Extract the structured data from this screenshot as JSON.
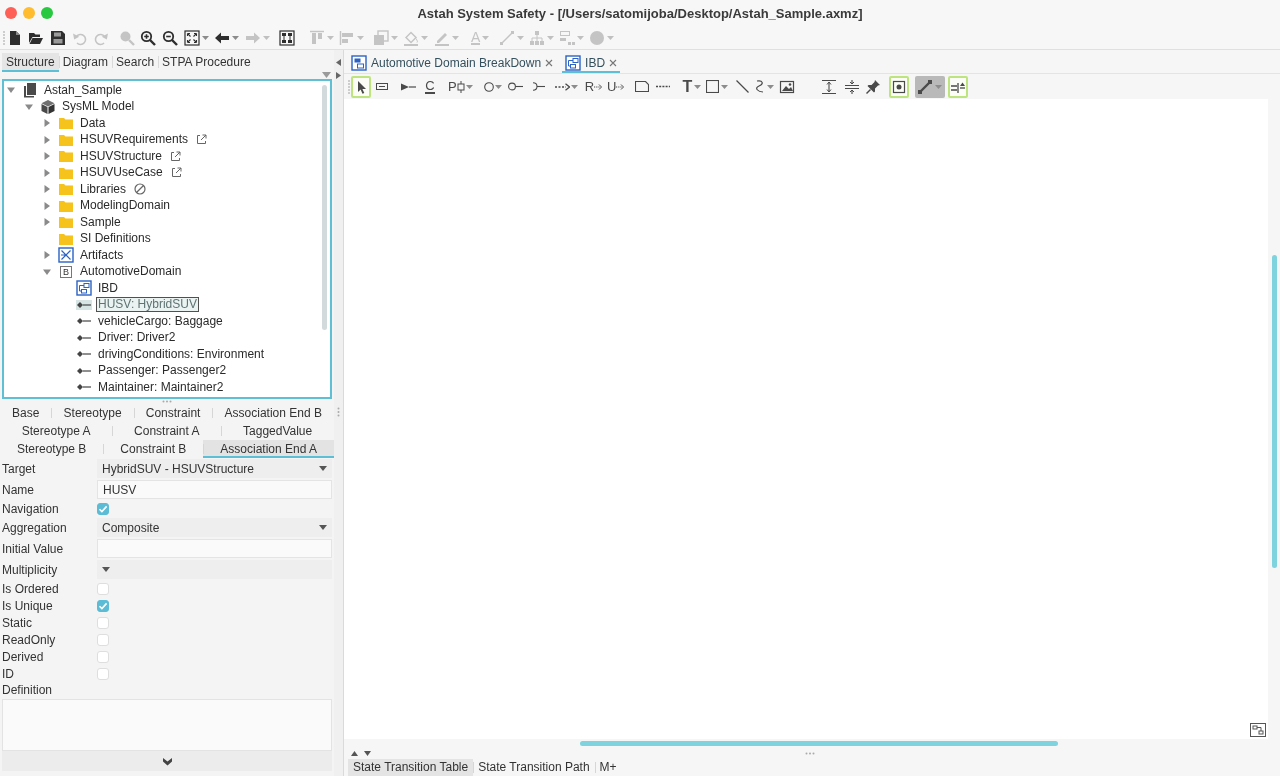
{
  "window": {
    "title": "Astah System Safety - [/Users/satomijoba/Desktop/Astah_Sample.axmz]"
  },
  "toolbar": [
    {
      "kind": "new",
      "disabled": false,
      "menu": false
    },
    {
      "kind": "open",
      "disabled": false,
      "menu": false
    },
    {
      "kind": "save",
      "disabled": false,
      "menu": false
    },
    {
      "kind": "undo",
      "disabled": true,
      "menu": false
    },
    {
      "kind": "redo",
      "disabled": true,
      "menu": false
    },
    {
      "kind": "find",
      "disabled": true,
      "menu": false
    },
    {
      "kind": "zoom-in",
      "disabled": false,
      "menu": false
    },
    {
      "kind": "zoom-out",
      "disabled": false,
      "menu": false
    },
    {
      "kind": "fit",
      "disabled": false,
      "menu": true
    },
    {
      "kind": "back",
      "disabled": false,
      "menu": true
    },
    {
      "kind": "forward",
      "disabled": true,
      "menu": true
    },
    {
      "kind": "layout",
      "disabled": false,
      "menu": false
    },
    {
      "kind": "align-top",
      "disabled": true,
      "menu": true
    },
    {
      "kind": "align-left",
      "disabled": true,
      "menu": true
    },
    {
      "kind": "arrange",
      "disabled": true,
      "menu": true
    },
    {
      "kind": "fill",
      "disabled": true,
      "menu": true
    },
    {
      "kind": "line-color",
      "disabled": true,
      "menu": true
    },
    {
      "kind": "font-color",
      "disabled": true,
      "menu": true,
      "glyph": "A"
    },
    {
      "kind": "line-style",
      "disabled": true,
      "menu": true
    },
    {
      "kind": "tree-layout",
      "disabled": true,
      "menu": true
    },
    {
      "kind": "distribute",
      "disabled": true,
      "menu": true
    },
    {
      "kind": "shape",
      "disabled": true,
      "menu": true
    }
  ],
  "left_panel": {
    "tabs": [
      {
        "label": "Structure",
        "selected": true
      },
      {
        "label": "Diagram",
        "selected": false
      },
      {
        "label": "Search",
        "selected": false
      },
      {
        "label": "STPA Procedure",
        "selected": false
      }
    ],
    "tree": [
      {
        "label": "Astah_Sample",
        "kind": "project",
        "expanded": true,
        "selected": false,
        "children": [
          {
            "label": "SysML Model",
            "kind": "model",
            "expanded": true,
            "selected": false,
            "children": [
              {
                "label": "Data",
                "kind": "folder",
                "expanded": false,
                "selected": false
              },
              {
                "label": "HSUVRequirements",
                "kind": "linked-folder",
                "expanded": false,
                "selected": false
              },
              {
                "label": "HSUVStructure",
                "kind": "linked-folder",
                "expanded": false,
                "selected": false
              },
              {
                "label": "HSUVUseCase",
                "kind": "linked-folder",
                "expanded": false,
                "selected": false
              },
              {
                "label": "Libraries",
                "kind": "blocked-folder",
                "expanded": false,
                "selected": false
              },
              {
                "label": "ModelingDomain",
                "kind": "folder",
                "expanded": false,
                "selected": false
              },
              {
                "label": "Sample",
                "kind": "folder",
                "expanded": false,
                "selected": false
              },
              {
                "label": "SI Definitions",
                "kind": "folder",
                "selected": false
              },
              {
                "label": "Artifacts",
                "kind": "diagram",
                "expanded": false,
                "selected": false
              },
              {
                "label": "AutomotiveDomain",
                "kind": "block",
                "glyph": "B",
                "expanded": true,
                "selected": false,
                "children": [
                  {
                    "label": "IBD",
                    "kind": "ibd",
                    "selected": false
                  },
                  {
                    "label": "HUSV: HybridSUV",
                    "kind": "part",
                    "selected": true
                  },
                  {
                    "label": "vehicleCargo: Baggage",
                    "kind": "part",
                    "selected": false
                  },
                  {
                    "label": "Driver: Driver2",
                    "kind": "part",
                    "selected": false
                  },
                  {
                    "label": "drivingConditions: Environment",
                    "kind": "part",
                    "selected": false
                  },
                  {
                    "label": "Passenger: Passenger2",
                    "kind": "part",
                    "selected": false
                  },
                  {
                    "label": "Maintainer: Maintainer2",
                    "kind": "part",
                    "selected": false
                  }
                ]
              }
            ]
          }
        ]
      }
    ]
  },
  "properties": {
    "tab_rows": [
      [
        {
          "label": "Base",
          "selected": false
        },
        {
          "label": "Stereotype",
          "selected": false
        },
        {
          "label": "Constraint",
          "selected": false
        },
        {
          "label": "Association End B",
          "selected": false
        }
      ],
      [
        {
          "label": "Stereotype A",
          "selected": false
        },
        {
          "label": "Constraint A",
          "selected": false
        },
        {
          "label": "TaggedValue",
          "selected": false
        }
      ],
      [
        {
          "label": "Stereotype B",
          "selected": false
        },
        {
          "label": "Constraint B",
          "selected": false
        },
        {
          "label": "Association End A",
          "selected": true
        }
      ]
    ],
    "fields": [
      {
        "label": "Target",
        "kind": "dropdown",
        "value": "HybridSUV - HSUVStructure"
      },
      {
        "label": "Name",
        "kind": "text",
        "value": "HUSV"
      },
      {
        "label": "Navigation",
        "kind": "checkbox",
        "checked": true
      },
      {
        "label": "Aggregation",
        "kind": "dropdown",
        "value": "Composite"
      },
      {
        "label": "Initial Value",
        "kind": "text"
      },
      {
        "label": "Multiplicity",
        "kind": "dropdown"
      },
      {
        "label": "Is Ordered",
        "kind": "checkbox",
        "checked": false
      },
      {
        "label": "Is Unique",
        "kind": "checkbox",
        "checked": true
      },
      {
        "label": "Static",
        "kind": "checkbox",
        "checked": false
      },
      {
        "label": "ReadOnly",
        "kind": "checkbox",
        "checked": false
      },
      {
        "label": "Derived",
        "kind": "checkbox",
        "checked": false
      },
      {
        "label": "ID",
        "kind": "checkbox",
        "checked": false
      },
      {
        "label": "Definition",
        "kind": "textarea"
      }
    ]
  },
  "editor": {
    "tabs": [
      {
        "label": "Automotive Domain BreakDown",
        "kind": "block-diagram",
        "selected": false
      },
      {
        "label": "IBD",
        "kind": "ibd",
        "selected": true
      }
    ],
    "tools": [
      {
        "kind": "select",
        "selected": true,
        "pressed": false,
        "menu": false
      },
      {
        "kind": "part",
        "selected": false,
        "pressed": false,
        "menu": false
      },
      {
        "kind": "flow-port",
        "selected": false,
        "pressed": false,
        "menu": false
      },
      {
        "kind": "constraint",
        "glyph": "C",
        "selected": false,
        "pressed": false,
        "menu": false
      },
      {
        "kind": "port",
        "glyph": "P",
        "selected": false,
        "pressed": false,
        "menu": true
      },
      {
        "kind": "circle",
        "selected": false,
        "pressed": false,
        "menu": true
      },
      {
        "kind": "interface",
        "selected": false,
        "pressed": false,
        "menu": false
      },
      {
        "kind": "required-interface",
        "selected": false,
        "pressed": false,
        "menu": false
      },
      {
        "kind": "dependency",
        "selected": false,
        "pressed": false,
        "menu": true
      },
      {
        "kind": "realization",
        "glyph": "R",
        "selected": false,
        "pressed": false,
        "menu": false
      },
      {
        "kind": "usage",
        "glyph": "U",
        "selected": false,
        "pressed": false,
        "menu": false
      },
      {
        "kind": "note",
        "selected": false,
        "pressed": false,
        "menu": false
      },
      {
        "kind": "anchor",
        "selected": false,
        "pressed": false,
        "menu": false
      },
      {
        "kind": "text",
        "glyph": "T",
        "selected": false,
        "pressed": false,
        "menu": true
      },
      {
        "kind": "rectangle",
        "selected": false,
        "pressed": false,
        "menu": true
      },
      {
        "kind": "line",
        "selected": false,
        "pressed": false,
        "menu": false
      },
      {
        "kind": "curve",
        "selected": false,
        "pressed": false,
        "menu": true
      },
      {
        "kind": "image",
        "selected": false,
        "pressed": false,
        "menu": false
      },
      {
        "kind": "space-vertical",
        "selected": false,
        "pressed": false,
        "menu": false
      },
      {
        "kind": "align-middle",
        "selected": false,
        "pressed": false,
        "menu": false
      },
      {
        "kind": "pin",
        "selected": false,
        "pressed": false,
        "menu": false
      },
      {
        "kind": "snap",
        "selected": true,
        "pressed": false,
        "menu": false
      },
      {
        "kind": "connector-style",
        "selected": false,
        "pressed": true,
        "menu": true
      },
      {
        "kind": "label-position",
        "selected": true,
        "pressed": false,
        "menu": false
      }
    ],
    "bottom_tabs": [
      {
        "label": "State Transition Table",
        "selected": true
      },
      {
        "label": "State Transition Path",
        "selected": false
      },
      {
        "label": "M+",
        "selected": false
      }
    ]
  }
}
